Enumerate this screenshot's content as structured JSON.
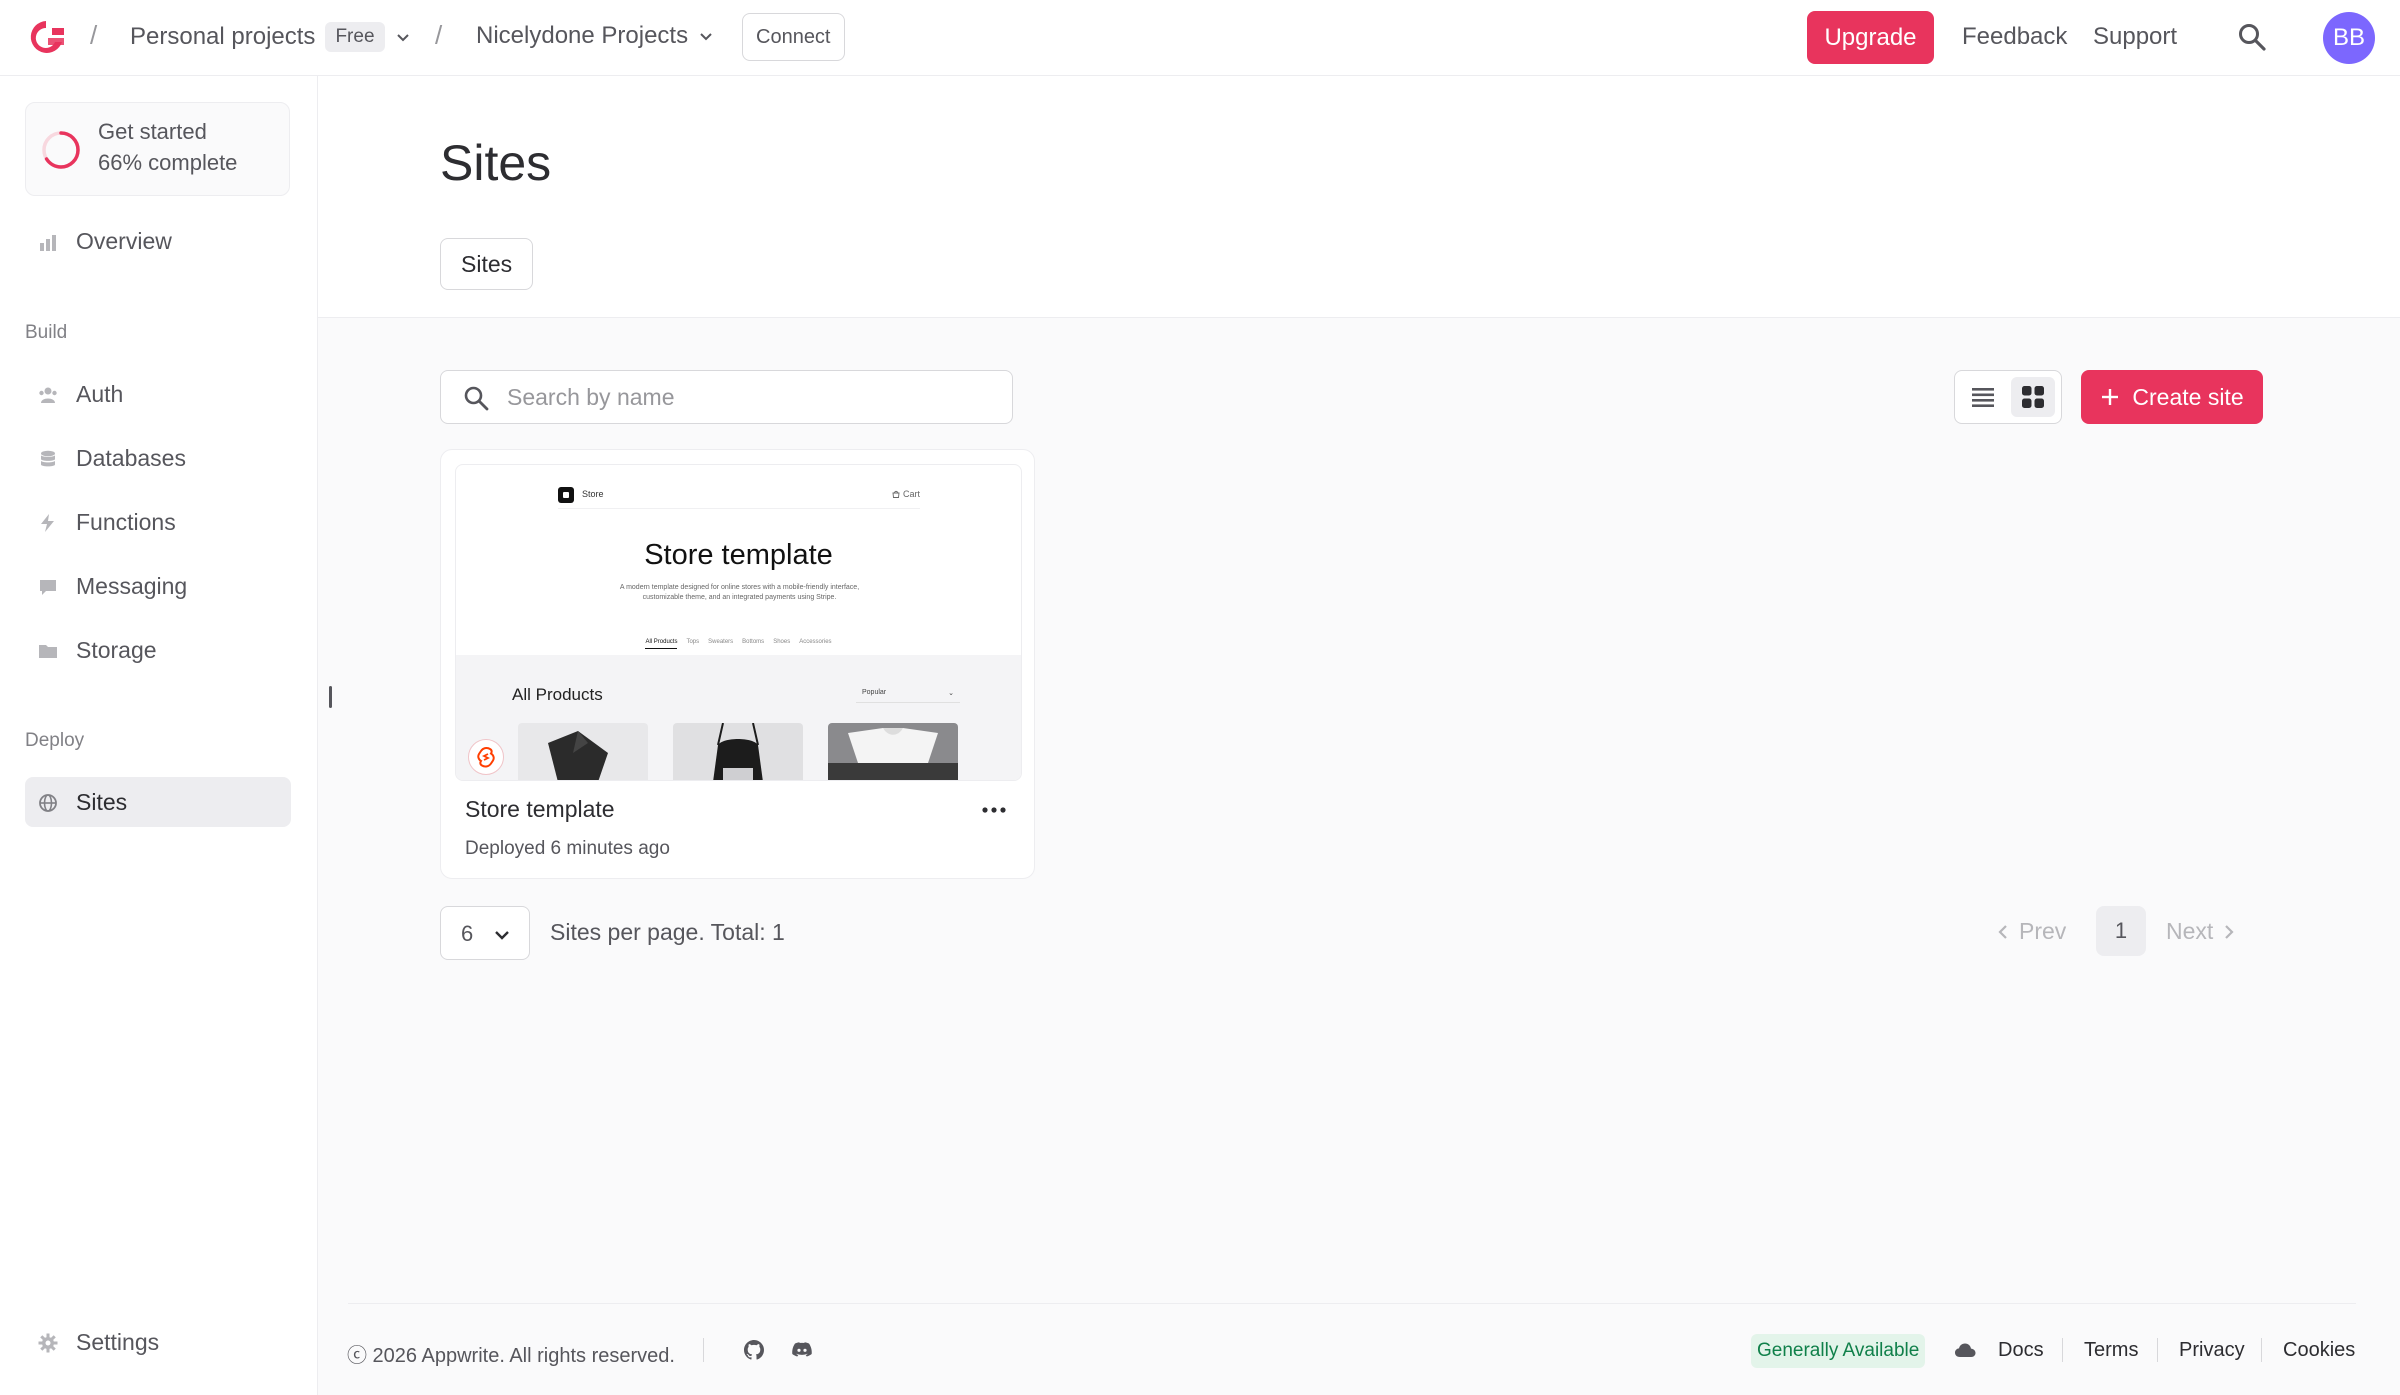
{
  "header": {
    "org_name": "Personal projects",
    "org_plan": "Free",
    "project_name": "Nicelydone Projects",
    "connect_label": "Connect",
    "upgrade_label": "Upgrade",
    "feedback_label": "Feedback",
    "support_label": "Support",
    "avatar_initials": "BB",
    "crumb_separator": "/"
  },
  "sidebar": {
    "get_started": {
      "title": "Get started",
      "progress_text": "66% complete",
      "progress": 0.66
    },
    "overview": "Overview",
    "build_label": "Build",
    "build_items": [
      "Auth",
      "Databases",
      "Functions",
      "Messaging",
      "Storage"
    ],
    "deploy_label": "Deploy",
    "deploy_items": [
      "Sites"
    ],
    "settings": "Settings"
  },
  "page": {
    "title": "Sites",
    "tab": "Sites",
    "search_placeholder": "Search by name",
    "create_label": "Create site"
  },
  "sites": [
    {
      "name": "Store template",
      "deployed": "Deployed 6 minutes ago",
      "preview": {
        "brand": "Store",
        "cart": "Cart",
        "headline": "Store template",
        "description": "A modern template designed for online stores with a mobile-friendly interface, customizable theme, and an integrated payments using Stripe.",
        "categories": [
          "All Products",
          "Tops",
          "Sweaters",
          "Bottoms",
          "Shoes",
          "Accessories"
        ],
        "section": "All Products",
        "sort": "Popular"
      }
    }
  ],
  "pagination": {
    "per_page": "6",
    "summary": "Sites per page. Total: 1",
    "prev": "Prev",
    "current": "1",
    "next": "Next"
  },
  "footer": {
    "copyright": "ⓒ 2026 Appwrite. All rights reserved.",
    "status": "Generally Available",
    "links": [
      "Docs",
      "Terms",
      "Privacy",
      "Cookies"
    ]
  },
  "colors": {
    "accent": "#e8345d",
    "avatar": "#7c67fe",
    "status_bg": "#e3f4ea",
    "status_text": "#10804a"
  }
}
